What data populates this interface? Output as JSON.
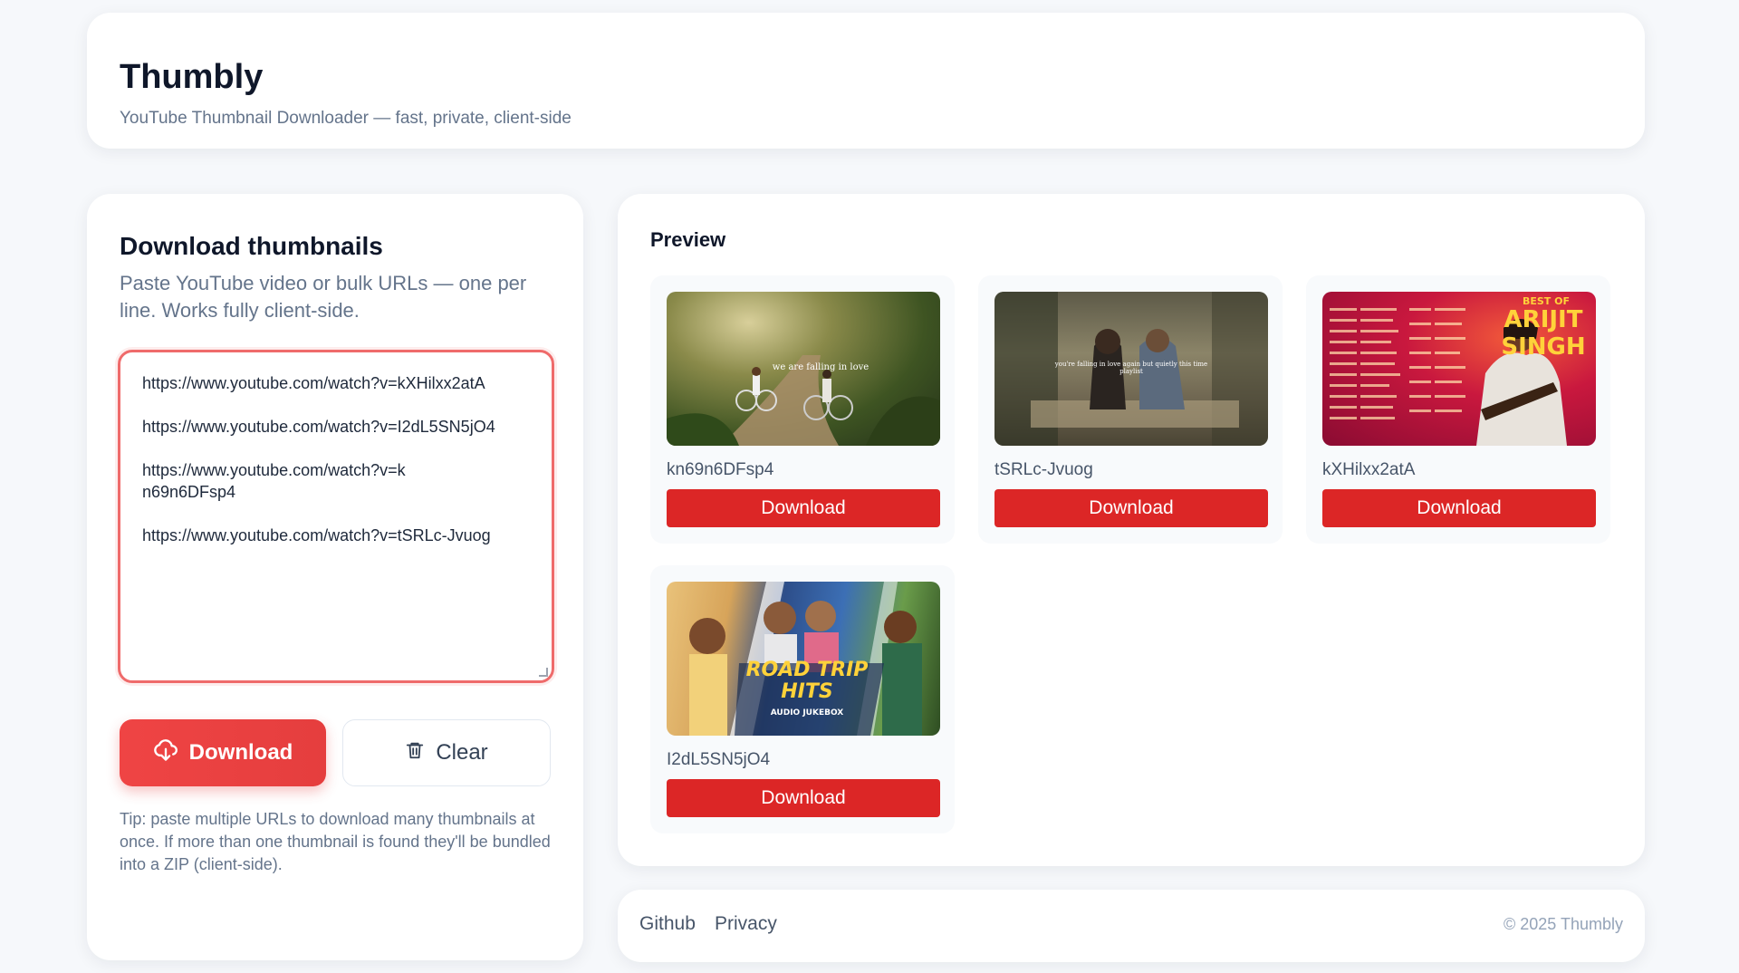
{
  "header": {
    "title": "Thumbly",
    "subtitle": "YouTube Thumbnail Downloader — fast, private, client-side"
  },
  "form": {
    "title": "Download thumbnails",
    "description": "Paste YouTube video or bulk URLs — one per line. Works fully client-side.",
    "urls": [
      "https://www.youtube.com/watch?v=kXHilxx2atA",
      "https://www.youtube.com/watch?v=I2dL5SN5jO4",
      "https://www.youtube.com/watch?v=kn69n6DFsp4",
      "https://www.youtube.com/watch?v=tSRLc-Jvuog"
    ],
    "download_label": "Download",
    "download_icon": "cloud-download-icon",
    "clear_label": "Clear",
    "clear_icon": "trash-icon",
    "tip": "Tip: paste multiple URLs to download many thumbnails at once. If more than one thumbnail is found they'll be bundled into a ZIP (client-side)."
  },
  "preview": {
    "title": "Preview",
    "items": [
      {
        "id": "kn69n6DFsp4",
        "button": "Download",
        "overlay": "we are falling in love"
      },
      {
        "id": "tSRLc-Jvuog",
        "button": "Download",
        "overlay": "you're falling in love again but quietly this time playlist"
      },
      {
        "id": "kXHilxx2atA",
        "button": "Download",
        "overlay_top": "BEST OF",
        "overlay_main": "ARIJIT SINGH"
      },
      {
        "id": "I2dL5SN5jO4",
        "button": "Download",
        "overlay_top": "ROAD TRIP",
        "overlay_main": "HITS",
        "overlay_sub": "AUDIO JUKEBOX"
      }
    ]
  },
  "footer": {
    "links": [
      "Github",
      "Privacy"
    ],
    "copyright": "© 2025 Thumbly"
  },
  "colors": {
    "accent": "#dc2626",
    "focus_border": "#ef6b6b",
    "text_muted": "#64748b"
  }
}
